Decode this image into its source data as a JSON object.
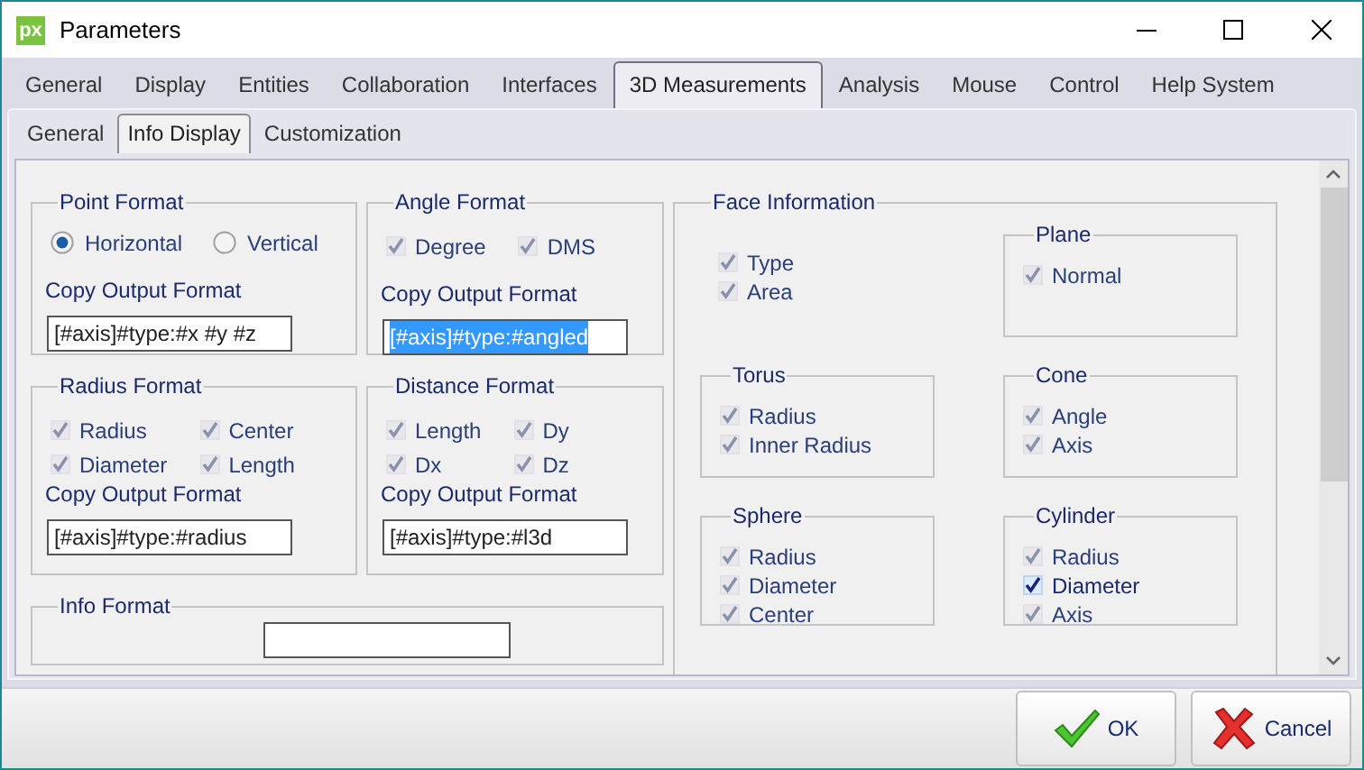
{
  "window": {
    "logo": "px",
    "title": "Parameters"
  },
  "tabs": [
    {
      "label": "General",
      "selected": false
    },
    {
      "label": "Display",
      "selected": false
    },
    {
      "label": "Entities",
      "selected": false
    },
    {
      "label": "Collaboration",
      "selected": false
    },
    {
      "label": "Interfaces",
      "selected": false
    },
    {
      "label": "3D Measurements",
      "selected": true
    },
    {
      "label": "Analysis",
      "selected": false
    },
    {
      "label": "Mouse",
      "selected": false
    },
    {
      "label": "Control",
      "selected": false
    },
    {
      "label": "Help System",
      "selected": false
    }
  ],
  "subtabs": [
    {
      "label": "General",
      "selected": false
    },
    {
      "label": "Info Display",
      "selected": true
    },
    {
      "label": "Customization",
      "selected": false
    }
  ],
  "format_groups": [
    {
      "title": "Point Format",
      "kind": "radio",
      "options": [
        {
          "label": "Horizontal",
          "selected": true
        },
        {
          "label": "Vertical",
          "selected": false
        }
      ],
      "output_label": "Copy Output Format",
      "output_value": "[#axis]#type:#x #y #z",
      "output_selected": false
    },
    {
      "title": "Angle Format",
      "kind": "check",
      "options": [
        {
          "label": "Degree",
          "checked": true,
          "disabled": true
        },
        {
          "label": "DMS",
          "checked": true,
          "disabled": true
        }
      ],
      "output_label": "Copy Output Format",
      "output_value": "[#axis]#type:#angled",
      "output_selected": true
    },
    {
      "title": "Radius Format",
      "kind": "check",
      "options": [
        {
          "label": "Radius",
          "checked": true,
          "disabled": true
        },
        {
          "label": "Center",
          "checked": true,
          "disabled": true
        },
        {
          "label": "Diameter",
          "checked": true,
          "disabled": true
        },
        {
          "label": "Length",
          "checked": true,
          "disabled": true
        }
      ],
      "output_label": "Copy Output Format",
      "output_value": "[#axis]#type:#radius",
      "output_selected": false
    },
    {
      "title": "Distance Format",
      "kind": "check",
      "options": [
        {
          "label": "Length",
          "checked": true,
          "disabled": true
        },
        {
          "label": "Dy",
          "checked": true,
          "disabled": true
        },
        {
          "label": "Dx",
          "checked": true,
          "disabled": true
        },
        {
          "label": "Dz",
          "checked": true,
          "disabled": true
        }
      ],
      "output_label": "Copy Output Format",
      "output_value": "[#axis]#type:#l3d",
      "output_selected": false
    }
  ],
  "info_format": {
    "title": "Info Format"
  },
  "face_information": {
    "title": "Face Information",
    "checks": [
      {
        "label": "Type",
        "checked": true,
        "disabled": true
      },
      {
        "label": "Area",
        "checked": true,
        "disabled": true
      }
    ],
    "groups": [
      {
        "title": "Plane",
        "checks": [
          {
            "label": "Normal",
            "checked": true,
            "disabled": true
          }
        ]
      },
      {
        "title": "Torus",
        "checks": [
          {
            "label": "Radius",
            "checked": true,
            "disabled": true
          },
          {
            "label": "Inner Radius",
            "checked": true,
            "disabled": true
          }
        ]
      },
      {
        "title": "Cone",
        "checks": [
          {
            "label": "Angle",
            "checked": true,
            "disabled": true
          },
          {
            "label": "Axis",
            "checked": true,
            "disabled": true
          }
        ]
      },
      {
        "title": "Sphere",
        "checks": [
          {
            "label": "Radius",
            "checked": true,
            "disabled": true
          },
          {
            "label": "Diameter",
            "checked": true,
            "disabled": true
          },
          {
            "label": "Center",
            "checked": true,
            "disabled": true
          }
        ]
      },
      {
        "title": "Cylinder",
        "checks": [
          {
            "label": "Radius",
            "checked": true,
            "disabled": true
          },
          {
            "label": "Diameter",
            "checked": true,
            "disabled": false
          },
          {
            "label": "Axis",
            "checked": true,
            "disabled": true
          }
        ]
      }
    ]
  },
  "buttons": [
    {
      "kind": "ok",
      "label": "OK"
    },
    {
      "kind": "cancel",
      "label": "Cancel"
    }
  ]
}
